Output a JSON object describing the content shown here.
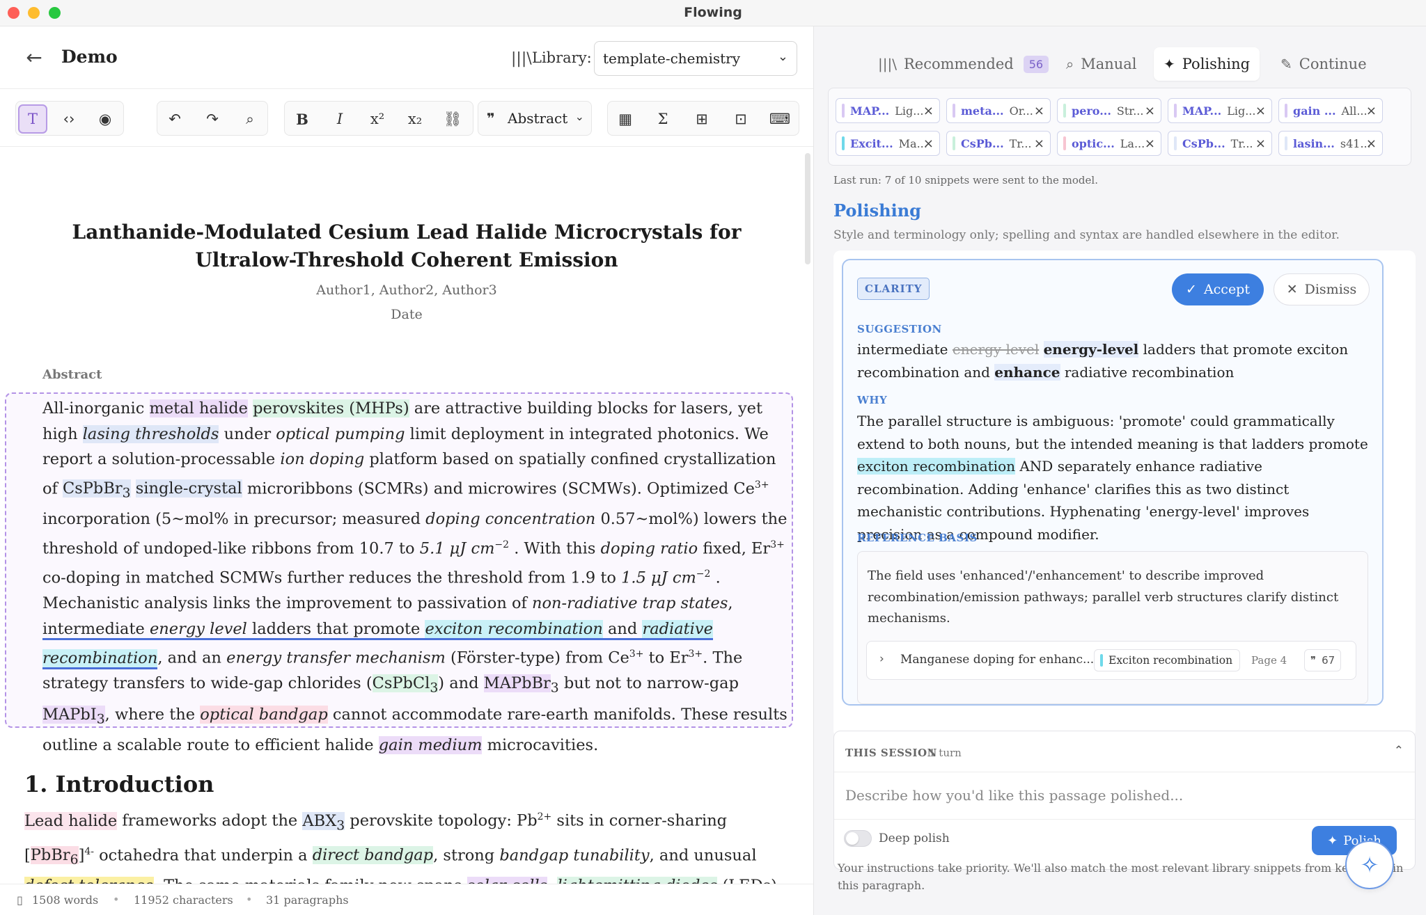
{
  "window": {
    "title": "Flowing"
  },
  "editor": {
    "doc_name": "Demo",
    "library_label": "Library:",
    "library_value": "template-chemistry",
    "block_style": "Abstract",
    "icons": [
      "text-mode-icon",
      "code-view-icon",
      "preview-eye-icon",
      "undo-icon",
      "redo-icon",
      "search-icon",
      "bold-icon",
      "italic-icon",
      "superscript-icon",
      "subscript-icon",
      "link-icon",
      "quote-icon",
      "calculator-icon",
      "sigma-icon",
      "table-icon",
      "image-plus-icon",
      "keyboard-icon"
    ],
    "toolbar_glyphs": {
      "text": "T",
      "code": "‹›",
      "preview": "◉",
      "undo": "↶",
      "redo": "↷",
      "search": "⌕",
      "bold": "B",
      "italic": "I",
      "sup": "x²",
      "sub": "x₂",
      "link": "⛓",
      "quote": "❞",
      "calc": "▦",
      "sigma": "Σ",
      "table": "⊞",
      "image": "⊡",
      "keyboard": "⌨"
    },
    "paper": {
      "title": "Lanthanide-Modulated Cesium Lead Halide Microcrystals for Ultralow-Threshold Coherent Emission",
      "authors": "Author1, Author2, Author3",
      "date": "Date",
      "abstract_label": "Abstract",
      "intro_heading": "1. Introduction"
    },
    "abstract_segments": [
      "All-inorganic ",
      "metal halide",
      " ",
      "perovskites (MHPs)",
      " are attractive building blocks for lasers, yet high ",
      "lasing thresholds",
      " under ",
      "optical pumping",
      " limit deployment in integrated photonics. We report a solution-processable ",
      "ion doping",
      " platform based on spatially confined crystallization of ",
      "CsPbBr",
      "3",
      " ",
      "single-crystal",
      " microribbons (SCMRs) and microwires (SCMWs). Optimized Ce",
      "3+",
      " incorporation (5~mol% in precursor; measured ",
      "doping concentration",
      " 0.57~mol%) lowers the threshold of undoped-like ribbons from ",
      "10.7",
      " to ",
      "5.1 μJ cm",
      "−2",
      " . With this ",
      "doping ratio",
      " fixed, Er",
      "3+",
      " co-doping in matched SCMWs further reduces the threshold from ",
      "1.9",
      " to ",
      "1.5 μJ cm",
      "−2",
      " . Mechanistic analysis links the improvement to passivation of ",
      "non-radiative trap states",
      ", ",
      "intermediate ",
      "energy level",
      " ladders that promote ",
      "exciton recombination",
      " and ",
      "radiative recombination",
      ", and an ",
      "energy transfer mechanism",
      " (Förster-type) from Ce",
      "3+",
      " to Er",
      "3+",
      ". The strategy transfers to wide-gap chlorides (",
      "CsPbCl",
      "3",
      ") and ",
      "MAPbBr",
      "3",
      " but not to narrow-gap ",
      "MAPbI",
      "3",
      ", where the ",
      "optical bandgap",
      " cannot accommodate rare-earth manifolds. These results outline a scalable route to efficient halide ",
      "gain medium",
      " microcavities."
    ],
    "intro_segments": [
      "Lead halide",
      " frameworks adopt the ",
      "ABX",
      "3",
      " perovskite topology: Pb",
      "2+",
      " sits in corner-sharing [",
      "PbBr",
      "6",
      "]",
      "4-",
      " octahedra that underpin a ",
      "direct bandgap",
      ", strong ",
      "bandgap tunability",
      ", and unusual ",
      "defect tolerance",
      ". The same materials family now spans ",
      "solar cells",
      ", ",
      "lightemitting diodes",
      " (LEDs), photodetectors, and coherent emitters, while micro- and nano-cavities promise compact sources"
    ],
    "status": {
      "words": "1508 words",
      "characters": "11952 characters",
      "paragraphs": "31 paragraphs"
    }
  },
  "panel": {
    "tabs": [
      {
        "label": "Recommended",
        "badge": "56",
        "icon": "library-icon"
      },
      {
        "label": "Manual",
        "icon": "search-icon"
      },
      {
        "label": "Polishing",
        "icon": "sparkle-icon",
        "active": true
      },
      {
        "label": "Continue",
        "icon": "pen-icon"
      }
    ],
    "chips": [
      {
        "tag": "MAP...",
        "rest": "Lig...",
        "color": "#d9c9f3"
      },
      {
        "tag": "meta...",
        "rest": "Or...",
        "color": "#d9c9f3"
      },
      {
        "tag": "pero...",
        "rest": "Str...",
        "color": "#c9f0dc"
      },
      {
        "tag": "MAP...",
        "rest": "Lig...",
        "color": "#d9c9f3"
      },
      {
        "tag": "gain ...",
        "rest": "All...",
        "color": "#d9c9f3"
      },
      {
        "tag": "Excit...",
        "rest": "Ma...",
        "color": "#6fd9ea"
      },
      {
        "tag": "CsPb...",
        "rest": "Tr...",
        "color": "#c9f0dc"
      },
      {
        "tag": "optic...",
        "rest": "La...",
        "color": "#f7c5d2"
      },
      {
        "tag": "CsPb...",
        "rest": "Tr...",
        "color": "#dfe7f7"
      },
      {
        "tag": "lasin...",
        "rest": "s41...",
        "color": "#dfe7f7"
      }
    ],
    "last_run": "Last run: 7 of 10 snippets were sent to the model.",
    "title": "Polishing",
    "subtitle": "Style and terminology only; spelling and syntax are handled elsewhere in the editor.",
    "card": {
      "badge": "CLARITY",
      "accept": "Accept",
      "dismiss": "Dismiss",
      "suggestion_label": "SUGGESTION",
      "suggestion": [
        "intermediate ",
        "energy level",
        " ",
        "energy-level",
        " ladders that promote exciton recombination and ",
        "enhance",
        " radiative recombination"
      ],
      "why_label": "WHY",
      "why": [
        "The parallel structure is ambiguous: 'promote' could grammatically extend to both nouns, but the intended meaning is that ladders promote ",
        "exciton recombination",
        " AND separately enhance radiative recombination. Adding 'enhance' clarifies this as two distinct mechanistic contributions. Hyphenating 'energy-level' improves precision as a compound modifier."
      ],
      "ref_label": "REFERENCE BASIS",
      "ref_text": "The field uses 'enhanced'/'enhancement' to describe improved recombination/emission pathways; parallel verb structures clarify distinct mechanisms.",
      "ref_item": {
        "title": "Manganese doping for enhanc...",
        "tag": "Exciton recombination",
        "page": "Page 4",
        "count": "67"
      }
    },
    "session": {
      "label": "THIS SESSION",
      "count": "1 turn",
      "placeholder": "Describe how you'd like this passage polished...",
      "deep_label": "Deep polish",
      "deep_polish_on": false,
      "polish_button": "Polish"
    },
    "footer": "Your instructions take priority. We'll also match the most relevant library snippets from keywords in this paragraph."
  }
}
